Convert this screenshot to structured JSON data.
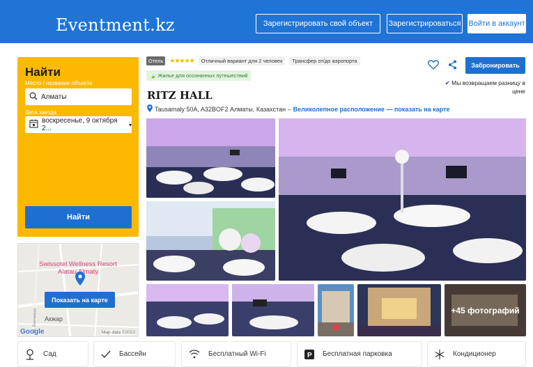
{
  "header": {
    "logo": "Eventment.kz",
    "register_object": "Зарегистрировать свой объект",
    "register": "Зарегистрироваться",
    "login": "Войти в аккаунт"
  },
  "search": {
    "title": "Найти",
    "place_label": "Место / название объекта",
    "place_value": "Алматы",
    "date_label": "Дата заезда",
    "date_value": "воскресенье, 9 октября 2...",
    "find_button": "Найти"
  },
  "map": {
    "poi": "Swissotel Wellness Resort Alatau Almaty",
    "button": "Показать на карте",
    "area": "Акжар",
    "street": "ул. Бахчевая",
    "google": "Google",
    "credit": "Map data ©2022"
  },
  "listing": {
    "type_badge": "Отель",
    "stars": "★★★★★",
    "tag1": "Отличный вариант для 2 человек",
    "tag2": "Трансфер от/до аэропорта",
    "eco": "Жилье для осознанных путешествий",
    "title": "RITZ HALL",
    "address": "Tausamaly 50A, A32BOF2 Алматы, Казахстан –",
    "location_link": "Великолепное расположение — показать на карте",
    "book_button": "Забронировать",
    "price_match": "Мы возвращаем разницу в цене",
    "more_photos": "+45 фотографий"
  },
  "amenities": [
    {
      "icon": "garden-icon",
      "label": "Сад"
    },
    {
      "icon": "check-icon",
      "label": "Бассейн"
    },
    {
      "icon": "wifi-icon",
      "label": "Бесплатный Wi-Fi"
    },
    {
      "icon": "parking-icon",
      "label": "Бесплатная парковка"
    },
    {
      "icon": "snowflake-icon",
      "label": "Кондиционер"
    }
  ],
  "colors": {
    "brand": "#1f74d6",
    "accent": "#fcb900",
    "button": "#1f6fd0"
  }
}
